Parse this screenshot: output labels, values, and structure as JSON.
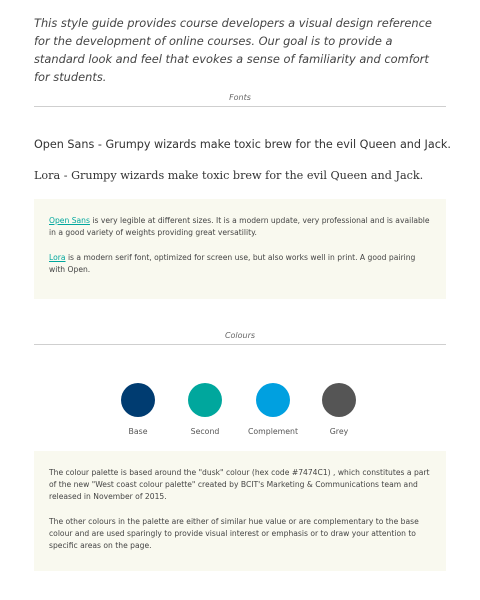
{
  "intro": {
    "text": "This style guide provides course developers a visual design reference for the development of online courses. Our goal is to provide a standard look and feel that evokes a sense of familiarity and comfort for students."
  },
  "fonts_section": {
    "heading": "Fonts",
    "sample_sans": "Open Sans - Grumpy wizards make toxic brew for the evil Queen and Jack.",
    "sample_serif": "Lora - Grumpy wizards make toxic brew for the evil Queen and Jack.",
    "notes": {
      "open_sans_link": "Open Sans",
      "open_sans_text": " is very legible at different sizes. It is a modern update, very professional and is available in a good variety of weights providing great versatility.",
      "lora_link": "Lora",
      "lora_text": " is a modern serif font, optimized for screen use, but also works well in print. A good pairing with Open."
    }
  },
  "colours_section": {
    "heading": "Colours",
    "swatches": [
      {
        "label": "Base",
        "color": "#003c71"
      },
      {
        "label": "Second",
        "color": "#00a79d"
      },
      {
        "label": "Complement",
        "color": "#00a0e0"
      },
      {
        "label": "Grey",
        "color": "#555555"
      }
    ],
    "notes": {
      "paragraph_1": "The colour palette is based around the \"dusk\" colour (hex code #7474C1) , which constitutes a part of the new \"West coast colour palette\" created by BCIT's Marketing & Communications team and released in November of 2015.",
      "paragraph_2": "The other colours in the palette are either of similar hue value or are complementary to the base colour and are used sparingly to provide visual interest or emphasis or to draw your attention to specific areas on the page."
    }
  }
}
